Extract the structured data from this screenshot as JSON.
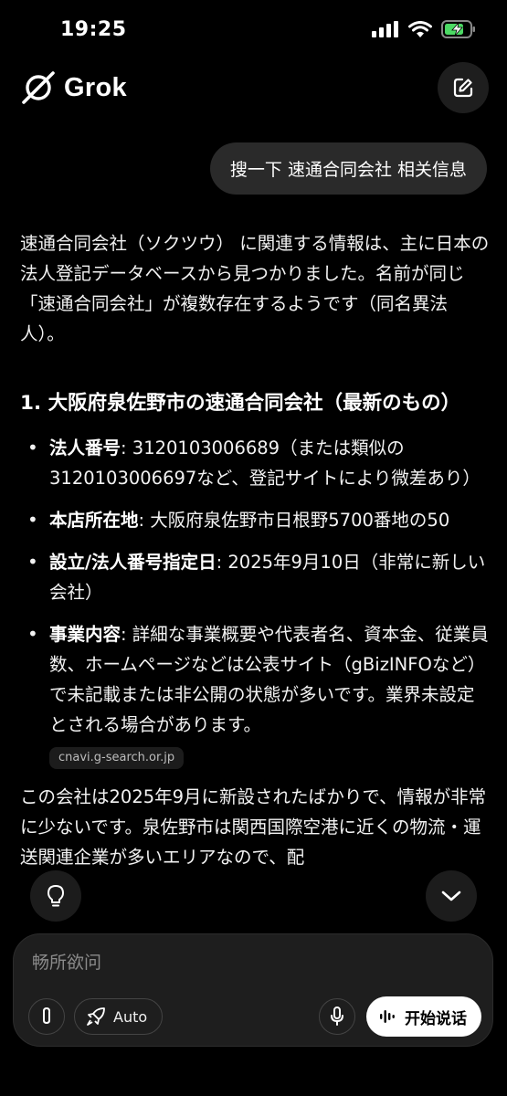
{
  "status": {
    "time": "19:25",
    "icons": [
      "signal-icon",
      "wifi-icon",
      "battery-charging-icon"
    ]
  },
  "header": {
    "app_name": "Grok",
    "new_chat_icon": "edit-icon"
  },
  "user_message": "搜一下 速通合同会社 相关信息",
  "response": {
    "intro": "速通合同会社（ソクツウ） に関連する情報は、主に日本の法人登記データベースから見つかりました。名前が同じ「速通合同会社」が複数存在するようです（同名異法人）。",
    "section_title": "1. 大阪府泉佐野市の速通合同会社（最新のもの）",
    "items": [
      {
        "label": "法人番号",
        "text": ": 3120103006689（または類似の3120103006697など、登記サイトにより微差あり）"
      },
      {
        "label": "本店所在地",
        "text": ": 大阪府泉佐野市日根野5700番地の50"
      },
      {
        "label": "設立/法人番号指定日",
        "text": ": 2025年9月10日（非常に新しい会社）"
      },
      {
        "label": "事業内容",
        "text": ": 詳細な事業概要や代表者名、資本金、従業員数、ホームページなどは公表サイト（gBizINFOなど）で未記載または非公開の状態が多いです。業界未設定とされる場合があります。"
      }
    ],
    "source": "cnavi.g-search.or.jp",
    "closing": "この会社は2025年9月に新設されたばかりで、情報が非常に少ないです。泉佐野市は関西国際空港に近くの物流・運送関連企業が多いエリアなので、配"
  },
  "composer": {
    "placeholder": "畅所欲问",
    "mode_label": "Auto",
    "voice_label": "开始说话"
  }
}
